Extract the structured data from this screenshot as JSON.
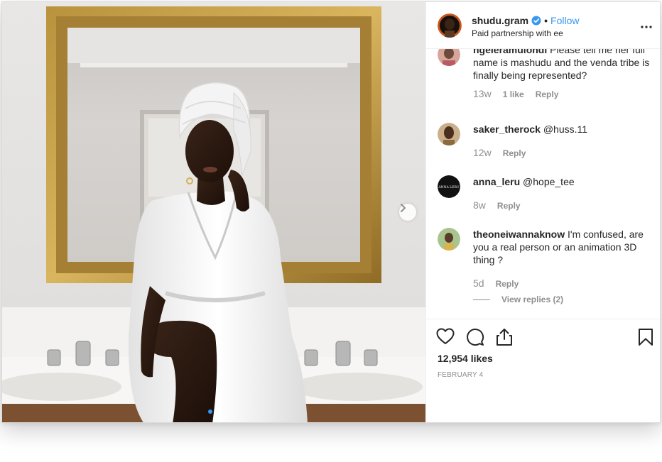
{
  "post": {
    "username": "shudu.gram",
    "separator": "•",
    "follow_label": "Follow",
    "subtitle": "Paid partnership with ee",
    "likes": "12,954 likes",
    "date": "FEBRUARY 4",
    "carousel_slides": 2,
    "carousel_active_index": 0
  },
  "comments": [
    {
      "user": "ngeleramulondi",
      "text": "Please tell me her full name is mashudu and the venda tribe is finally being represented?",
      "time": "13w",
      "likes": "1 like",
      "reply": "Reply"
    },
    {
      "user": "saker_therock",
      "text": "@huss.11",
      "time": "12w",
      "reply": "Reply"
    },
    {
      "user": "anna_leru",
      "text": "@hope_tee",
      "time": "8w",
      "reply": "Reply",
      "avatar_text": "ANNA LERU"
    },
    {
      "user": "theoneiwannaknow",
      "text": "I'm confused, are you a real person or an animation 3D thing ?",
      "time": "5d",
      "reply": "Reply",
      "view_replies": "View replies (2)"
    }
  ],
  "icons": {
    "verified": "verified-badge-icon",
    "more": "more-options-icon",
    "next": "chevron-right-icon",
    "like": "heart-icon",
    "comment": "comment-bubble-icon",
    "share": "share-icon",
    "save": "bookmark-icon"
  },
  "colors": {
    "accent": "#3897f0",
    "text": "#262626",
    "secondary": "#8e8e8e",
    "border": "#efefef"
  }
}
